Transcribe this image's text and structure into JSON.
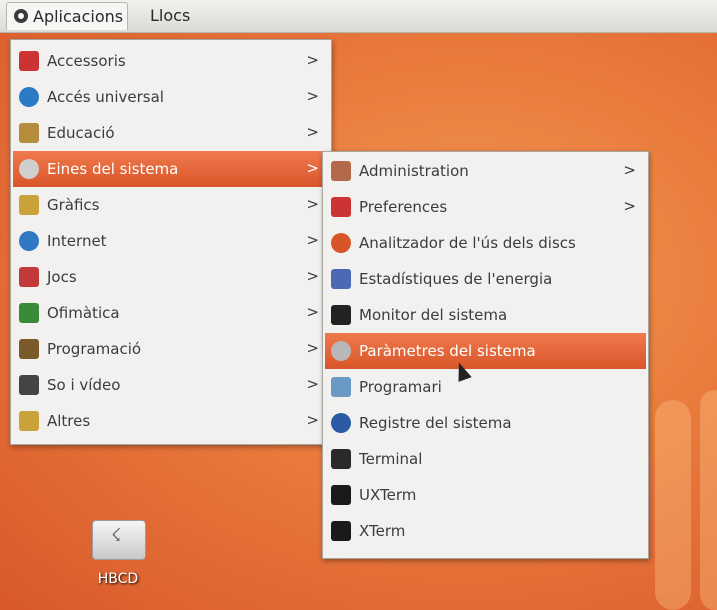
{
  "panel": {
    "apps_label": "Aplicacions",
    "places_label": "Llocs"
  },
  "main_menu": {
    "arrow": ">",
    "items": [
      {
        "label": "Accessoris",
        "icon": "accessories-icon",
        "color": "#c33"
      },
      {
        "label": "Accés universal",
        "icon": "universal-access-icon",
        "color": "#2a7bc3"
      },
      {
        "label": "Educació",
        "icon": "education-icon",
        "color": "#b58c3c"
      },
      {
        "label": "Eines del sistema",
        "icon": "system-tools-icon",
        "color": "#cfcfcf"
      },
      {
        "label": "Gràfics",
        "icon": "graphics-icon",
        "color": "#c9a23a"
      },
      {
        "label": "Internet",
        "icon": "internet-icon",
        "color": "#2f79c2"
      },
      {
        "label": "Jocs",
        "icon": "games-icon",
        "color": "#c23a3a"
      },
      {
        "label": "Ofimàtica",
        "icon": "office-icon",
        "color": "#3a8a3a"
      },
      {
        "label": "Programació",
        "icon": "programming-icon",
        "color": "#7a5a2a"
      },
      {
        "label": "So i vídeo",
        "icon": "sound-video-icon",
        "color": "#444"
      },
      {
        "label": "Altres",
        "icon": "other-icon",
        "color": "#c9a23a"
      }
    ]
  },
  "sub_menu": {
    "arrow": ">",
    "items": [
      {
        "label": "Administration",
        "icon": "administration-icon",
        "color": "#b46a4a"
      },
      {
        "label": "Preferences",
        "icon": "preferences-icon",
        "color": "#c33"
      },
      {
        "label": "Analitzador de l'ús dels discs",
        "icon": "disk-usage-icon",
        "color": "#d8552a"
      },
      {
        "label": "Estadístiques de l'energia",
        "icon": "power-statistics-icon",
        "color": "#4a6ab4"
      },
      {
        "label": "Monitor del sistema",
        "icon": "system-monitor-icon",
        "color": "#222"
      },
      {
        "label": "Paràmetres del sistema",
        "icon": "system-settings-icon",
        "color": "#b8b8b8"
      },
      {
        "label": "Programari",
        "icon": "software-icon",
        "color": "#6a9ac4"
      },
      {
        "label": "Registre del sistema",
        "icon": "system-log-icon",
        "color": "#2a5aa4"
      },
      {
        "label": "Terminal",
        "icon": "terminal-icon",
        "color": "#2a2a2a"
      },
      {
        "label": "UXTerm",
        "icon": "uxterm-icon",
        "color": "#1a1a1a"
      },
      {
        "label": "XTerm",
        "icon": "xterm-icon",
        "color": "#1a1a1a"
      }
    ]
  },
  "desktop": {
    "drive_label": "HBCD"
  }
}
